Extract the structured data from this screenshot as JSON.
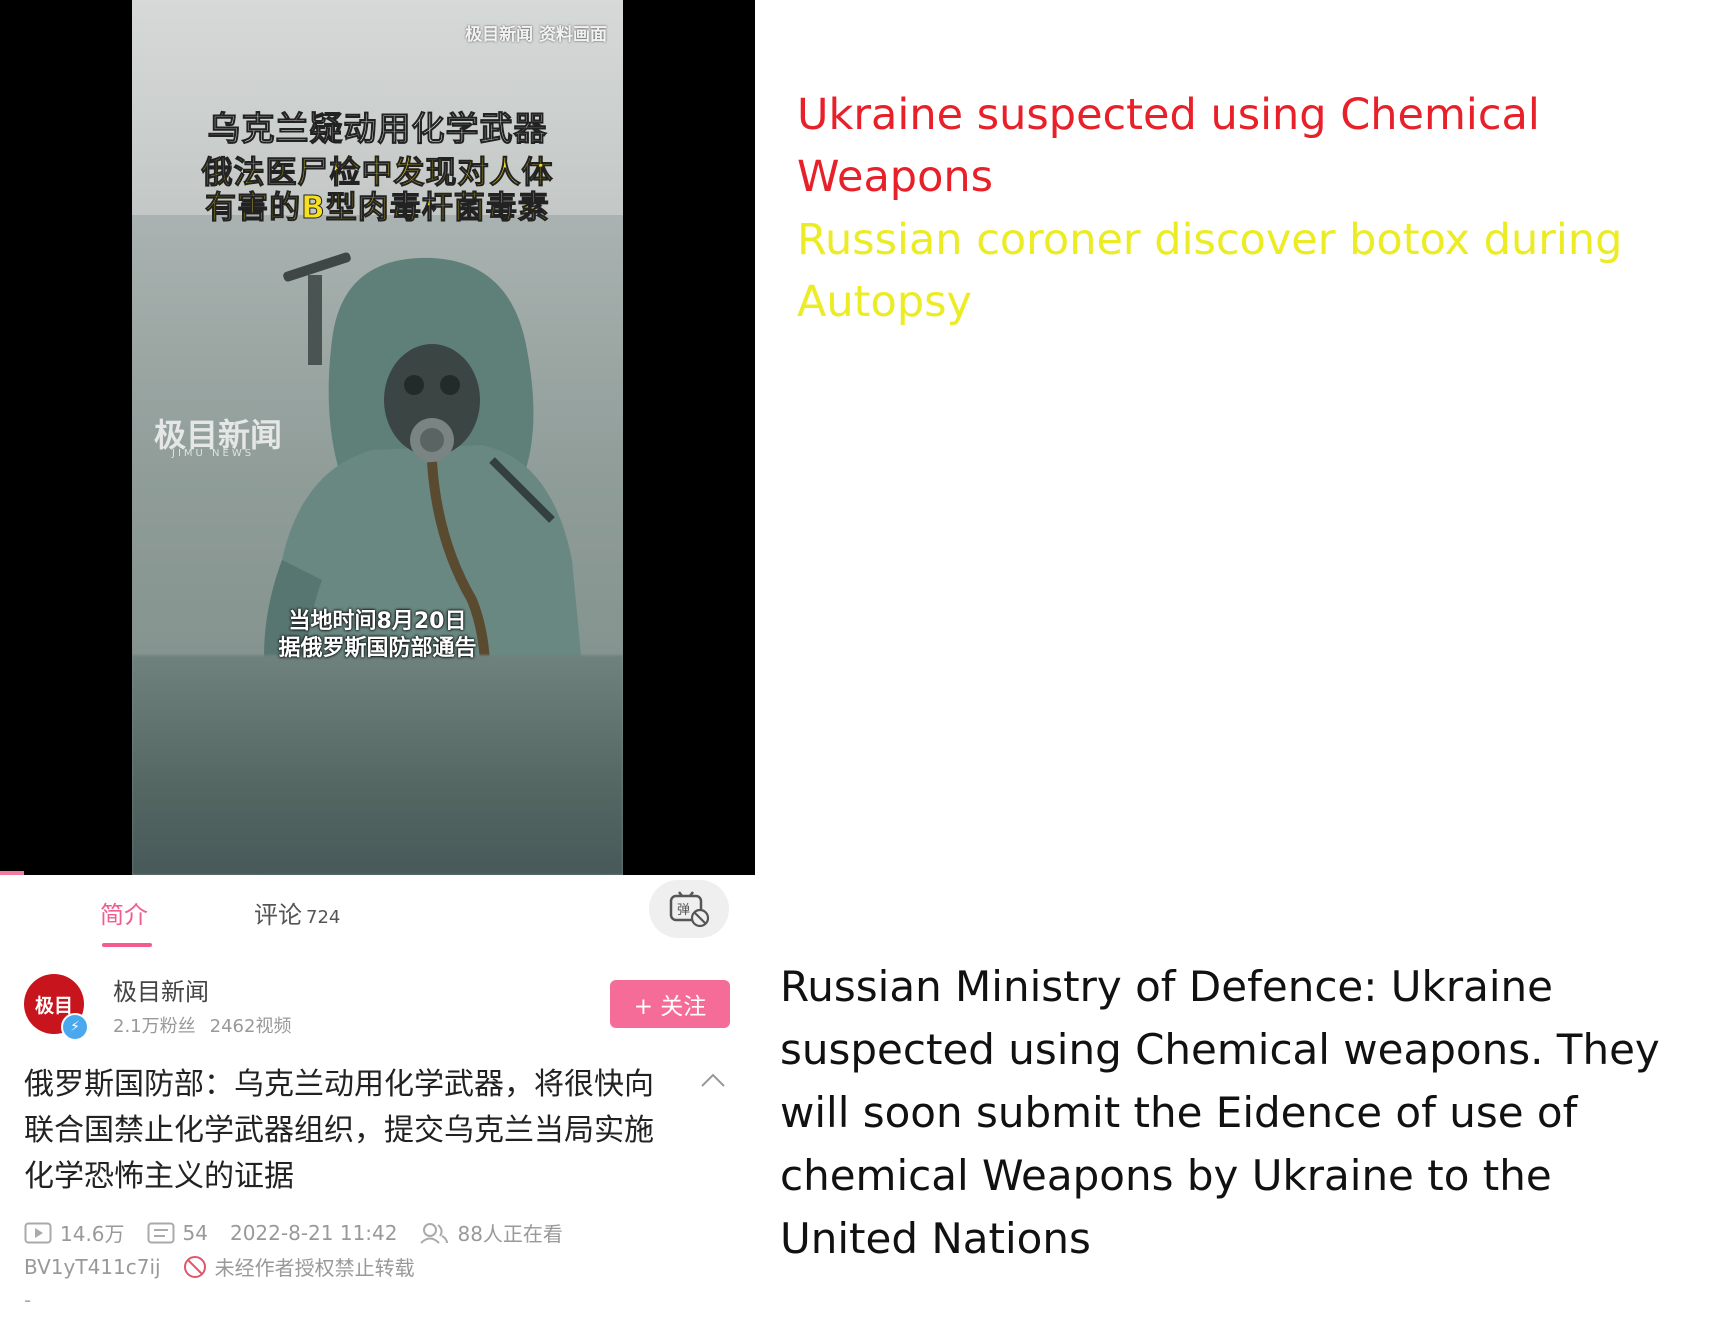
{
  "video": {
    "watermark_top": "极目新闻 资料画面",
    "headline_line1": "乌克兰疑动用化学武器",
    "headline_line2": "俄法医尸检中发现对人体",
    "headline_line3": "有害的B型肉毒杆菌毒素",
    "logo_text": "极目新闻",
    "logo_subtext": "JIMU NEWS",
    "subtitle_line1": "当地时间8月20日",
    "subtitle_line2": "据俄罗斯国防部通告"
  },
  "captions": {
    "red": "Ukraine suspected using Chemical Weapons",
    "yellow": "Russian coroner discover botox during Autopsy",
    "black": "Russian Ministry of Defence: Ukraine suspected using Chemical weapons. They will soon submit the Eidence of use of chemical Weapons by Ukraine to the United Nations",
    "colors": {
      "red": "#e8202a",
      "yellow": "#ecec24",
      "black": "#111111"
    }
  },
  "tabs": {
    "intro_label": "简介",
    "comments_label": "评论",
    "comments_count": "724",
    "danmaku_icon": "danmaku-off-icon"
  },
  "uploader": {
    "avatar_text": "极目",
    "name": "极目新闻",
    "followers": "2.1万粉丝",
    "videos": "2462视频",
    "follow_label": "+ 关注"
  },
  "video_info": {
    "title": "俄罗斯国防部：乌克兰动用化学武器，将很快向联合国禁止化学武器组织，提交乌克兰当局实施化学恐怖主义的证据",
    "views": "14.6万",
    "danmaku_count": "54",
    "publish_time": "2022-8-21 11:42",
    "watching": "88人正在看",
    "bvid": "BV1yT411c7ij",
    "copyright_notice": "未经作者授权禁止转载"
  },
  "colors": {
    "accent_pink": "#f25d8e",
    "follow_pink": "#f56c98"
  }
}
